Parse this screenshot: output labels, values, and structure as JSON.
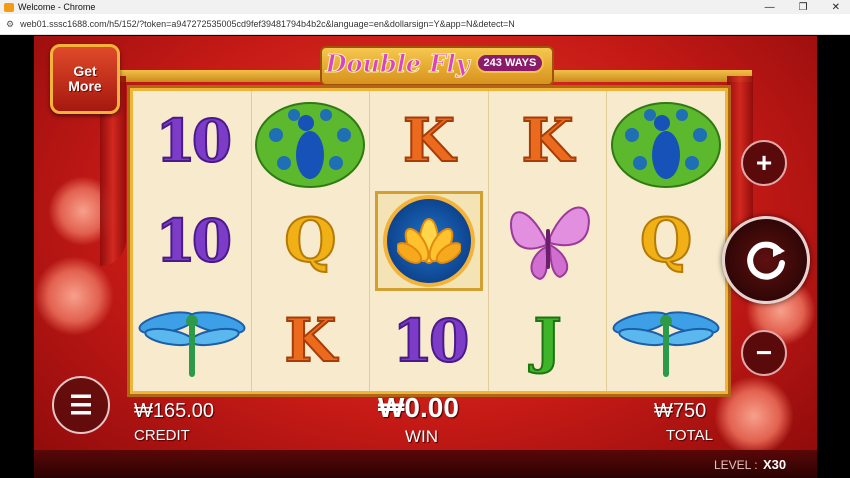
{
  "browser": {
    "window_title": "Welcome - Chrome",
    "url": "web01.sssc1688.com/h5/152/?token=a947272535005cd9fef39481794b4b2c&language=en&dollarsign=Y&app=N&detect=N",
    "controls": [
      "—",
      "❐",
      "✕"
    ]
  },
  "game": {
    "logo_name": "Double Fly",
    "logo_ways": "243 WAYS",
    "get_more": [
      "Get",
      "More"
    ],
    "reels": [
      [
        "10",
        "10",
        "dragonfly"
      ],
      [
        "peacock",
        "Q",
        "K"
      ],
      [
        "K",
        "lotus-wild",
        "10"
      ],
      [
        "K",
        "butterfly",
        "J"
      ],
      [
        "peacock",
        "Q",
        "dragonfly"
      ]
    ],
    "buttons": {
      "plus": "+",
      "minus": "−",
      "spin": "↻",
      "menu": "☰"
    },
    "credit_value": "₩165.00",
    "credit_label": "CREDIT",
    "win_value": "₩0.00",
    "win_label": "WIN",
    "total_value": "₩750",
    "total_label": "TOTAL",
    "level_label": "LEVEL :",
    "level_value": "X30"
  }
}
